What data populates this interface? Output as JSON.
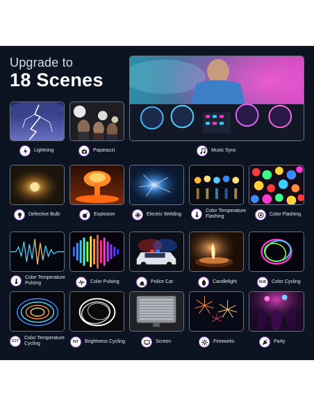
{
  "heading": {
    "line1": "Upgrade to",
    "line2": "18 Scenes"
  },
  "scenes": [
    {
      "label": "Lightning",
      "icon": "lightning-icon"
    },
    {
      "label": "Paparazzi",
      "icon": "camera-icon"
    },
    {
      "label": "Music Sync",
      "icon": "music-note-icon"
    },
    {
      "label": "Defective Bulb",
      "icon": "bulb-icon"
    },
    {
      "label": "Explosion",
      "icon": "bomb-icon"
    },
    {
      "label": "Electric Welding",
      "icon": "spark-icon"
    },
    {
      "label": "Color Temperature Flashing",
      "icon": "thermometer-icon"
    },
    {
      "label": "Color Flashing",
      "icon": "flash-circle-icon"
    },
    {
      "label": "Color Temperature Pulsing",
      "icon": "thermometer-pulse-icon"
    },
    {
      "label": "Color Pulsing",
      "icon": "pulse-icon"
    },
    {
      "label": "Police Car",
      "icon": "siren-icon"
    },
    {
      "label": "Candlelight",
      "icon": "flame-icon"
    },
    {
      "label": "Color Cycling",
      "icon": "hue-icon",
      "badge": "HUE"
    },
    {
      "label": "Color Temperature Cycling",
      "icon": "cct-icon",
      "badge": "CCT"
    },
    {
      "label": "Brightness Cycling",
      "icon": "int-icon",
      "badge": "INT"
    },
    {
      "label": "Screen",
      "icon": "screen-icon"
    },
    {
      "label": "Fireworks",
      "icon": "firework-icon"
    },
    {
      "label": "Party",
      "icon": "party-icon"
    }
  ]
}
